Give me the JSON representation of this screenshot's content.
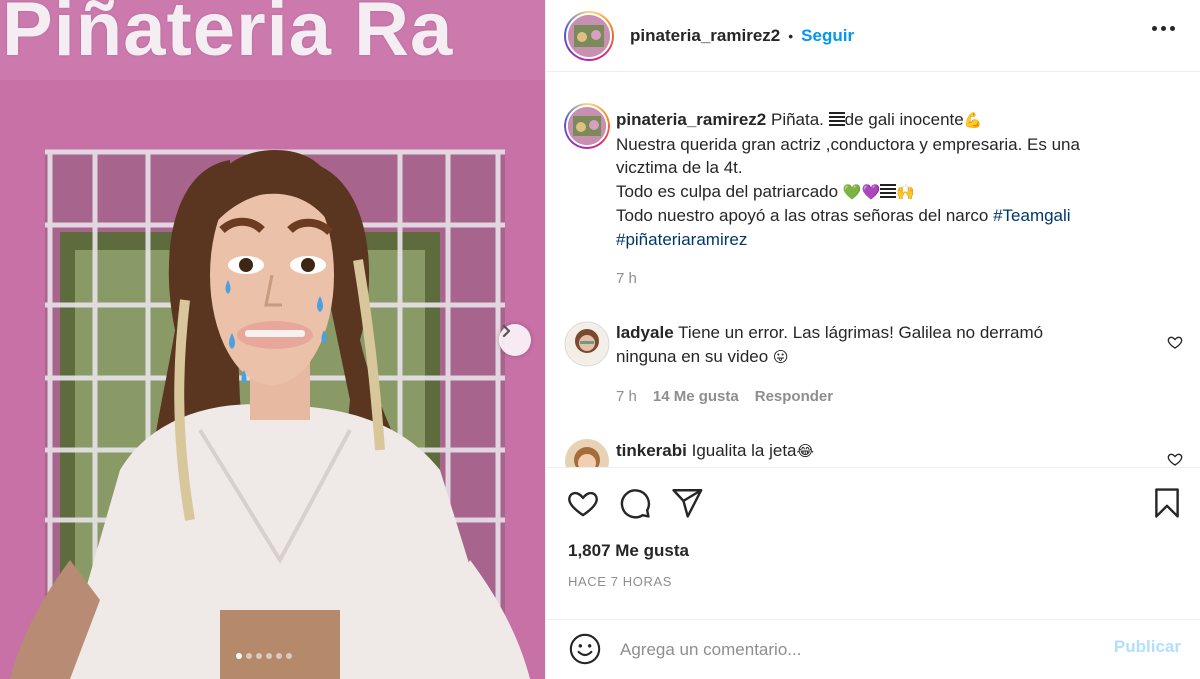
{
  "photo": {
    "sign_text": "Piñateria Ra",
    "carousel_dots": 6,
    "active_dot": 0
  },
  "header": {
    "username": "pinateria_ramirez2",
    "separator": "•",
    "follow_label": "Seguir"
  },
  "caption": {
    "username": "pinateria_ramirez2",
    "line1": "Piñata. ",
    "line1_b": "de gali inocente",
    "emoji_flex": "💪",
    "line2": "Nuestra querida gran actriz ,conductora y empresaria. Es una",
    "line3": "vicztima de la 4t.",
    "line4": "Todo es culpa del patriarcado ",
    "line4_emoji": "💚💜",
    "line4_emoji2": "🙌",
    "line5": "Todo nuestro apoyó a las otras señoras del narco ",
    "hashtag1": "#Teamgali",
    "hashtag2": "#piñateriaramirez",
    "time": "7 h"
  },
  "comments": [
    {
      "username": "ladyale",
      "text1": "Tiene un error. Las lágrimas! Galilea no derramó",
      "text2": "ninguna en su video ",
      "emoji": "😛",
      "time": "7 h",
      "likes": "14 Me gusta",
      "reply": "Responder"
    },
    {
      "username": "tinkerabi",
      "text1": "Igualita la jeta",
      "emoji": "😂"
    }
  ],
  "actions": {
    "likes": "1,807 Me gusta",
    "timestamp": "HACE 7 HORAS"
  },
  "add_comment": {
    "placeholder": "Agrega un comentario...",
    "publish_label": "Publicar"
  },
  "colors": {
    "accent": "#0095f6",
    "hashtag": "#00376b",
    "muted": "#8e8e8e",
    "publish_disabled": "#b2dffc"
  }
}
